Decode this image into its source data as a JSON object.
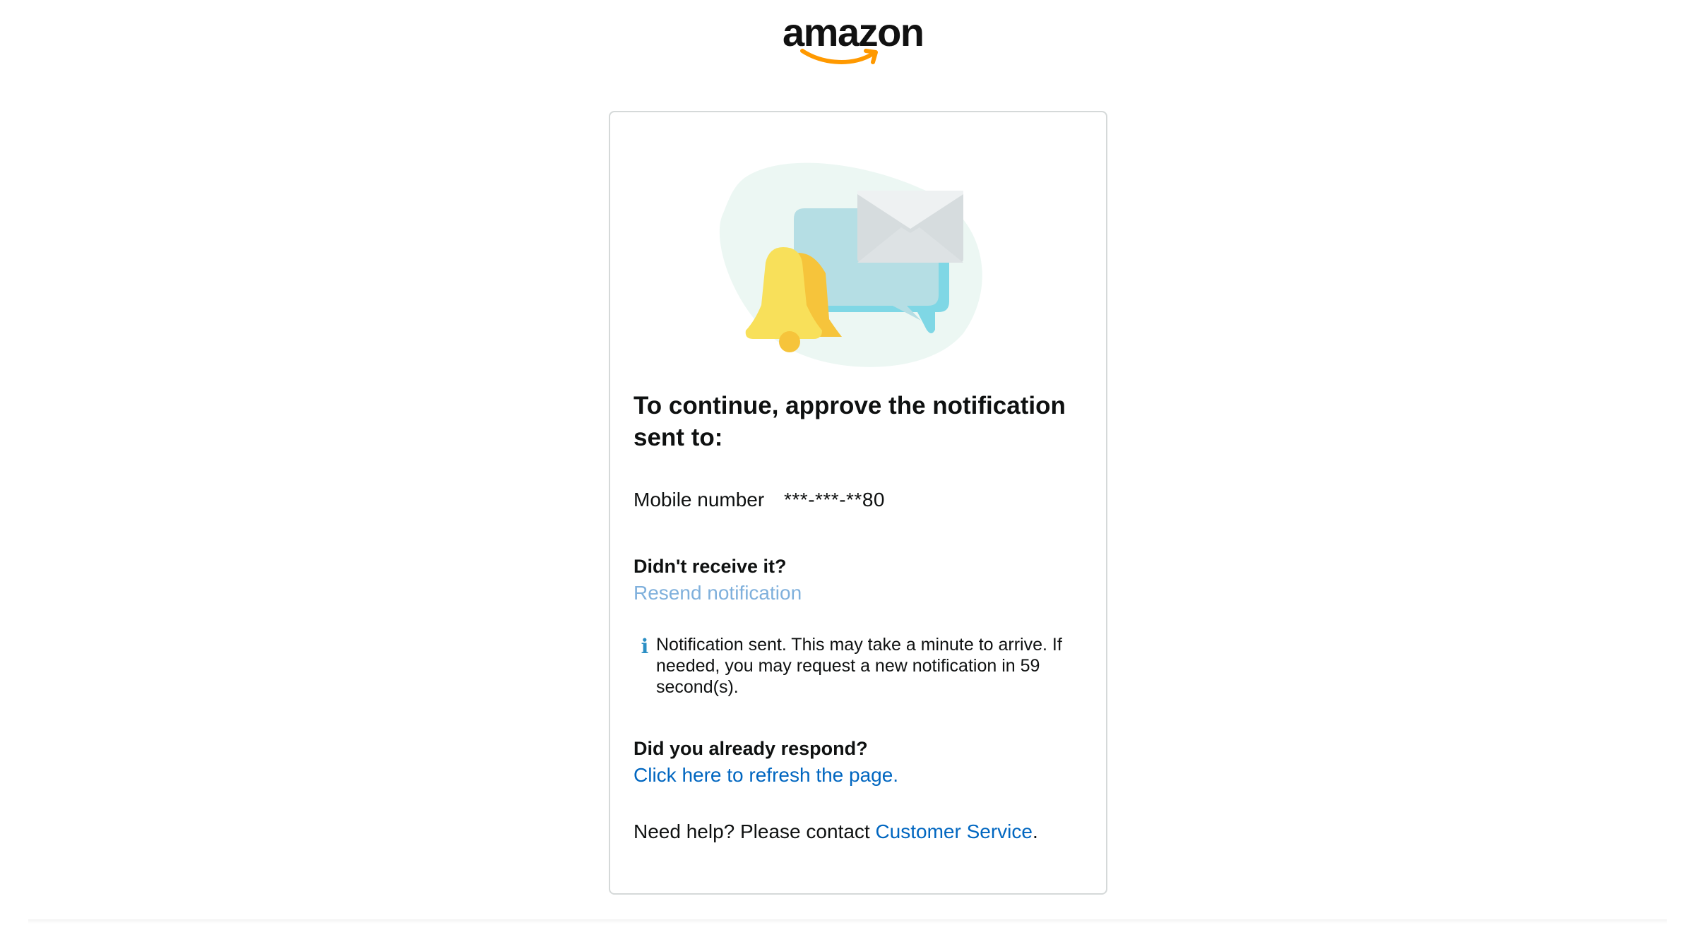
{
  "logo": {
    "text": "amazon",
    "accent_color": "#f90"
  },
  "heading": "To continue, approve the notification sent to:",
  "mobile": {
    "label": "Mobile number",
    "value": "***-***-**80"
  },
  "resend": {
    "title": "Didn't receive it?",
    "link": "Resend notification"
  },
  "info": {
    "icon": "i",
    "text": "Notification sent. This may take a minute to arrive. If needed, you may request a new notification in 59 second(s)."
  },
  "respond": {
    "title": "Did you already respond?",
    "link": "Click here to refresh the page."
  },
  "help": {
    "prefix": "Need help? Please contact ",
    "link": "Customer Service",
    "suffix": "."
  },
  "colors": {
    "link": "#0066c0",
    "link_disabled": "#7fb0dc",
    "info_icon": "#2a8ec4",
    "card_border": "#d5d9d9"
  }
}
